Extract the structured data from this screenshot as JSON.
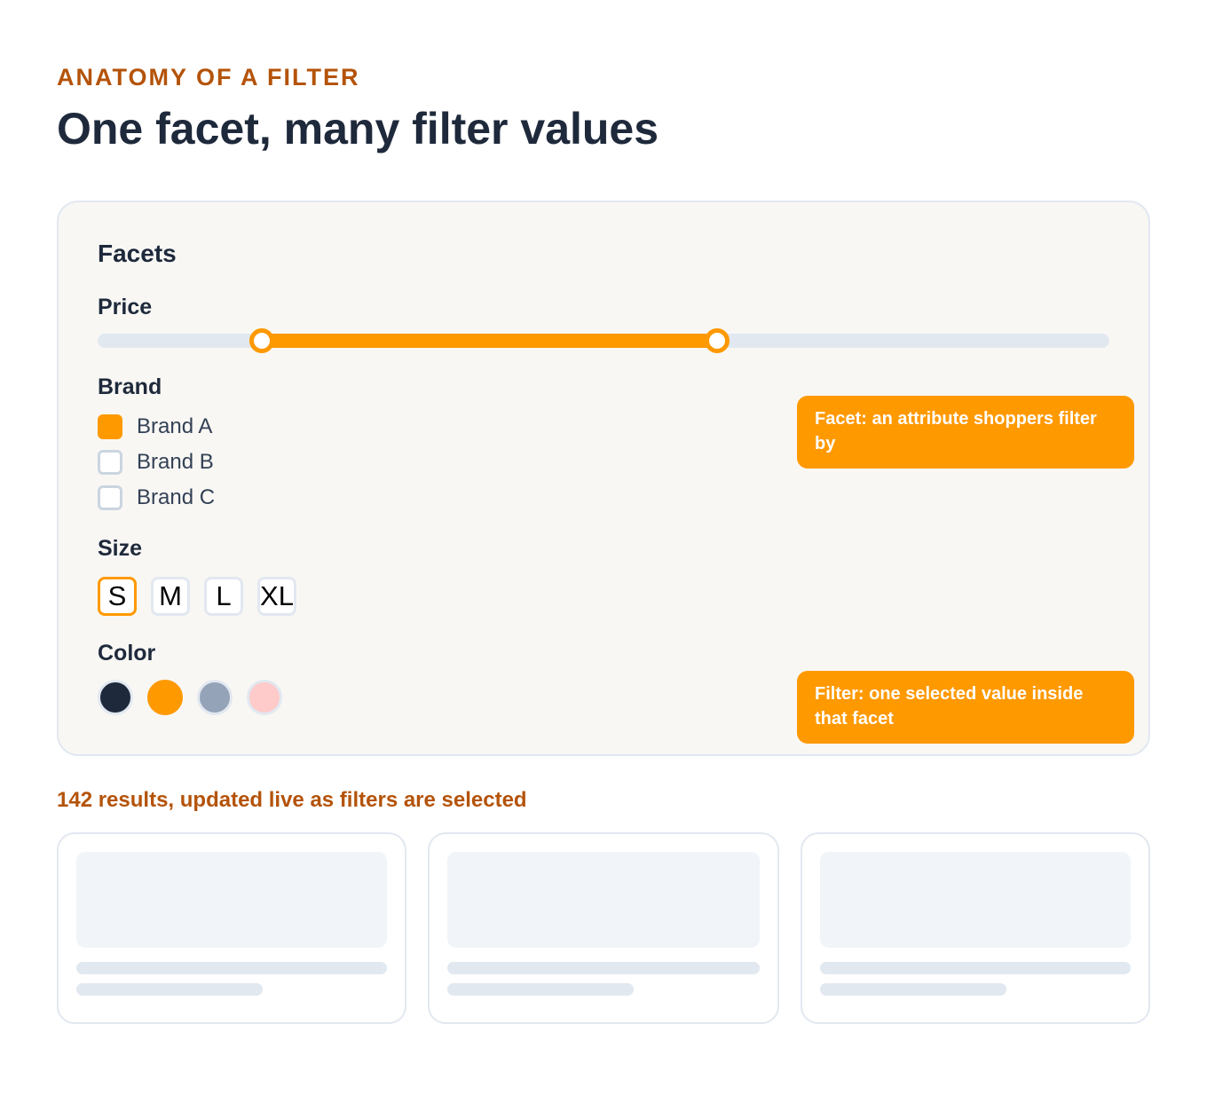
{
  "header": {
    "eyebrow": "ANATOMY OF A FILTER",
    "title": "One facet, many filter values"
  },
  "panel": {
    "title": "Facets",
    "price": {
      "label": "Price",
      "range_start_fraction": 0.162,
      "range_end_fraction": 0.612
    },
    "brand": {
      "label": "Brand",
      "options": [
        {
          "label": "Brand A",
          "checked": true
        },
        {
          "label": "Brand B",
          "checked": false
        },
        {
          "label": "Brand C",
          "checked": false
        }
      ]
    },
    "size": {
      "label": "Size",
      "options": [
        {
          "label": "S",
          "selected": true
        },
        {
          "label": "M",
          "selected": false
        },
        {
          "label": "L",
          "selected": false
        },
        {
          "label": "XL",
          "selected": false
        }
      ]
    },
    "color": {
      "label": "Color",
      "swatches": [
        "#1e293b",
        "#ff9900",
        "#94a3b8",
        "#fecaca"
      ],
      "selected_index": 1
    }
  },
  "callouts": {
    "facet": "Facet: an attribute shoppers filter by",
    "filter": "Filter: one selected value inside that facet"
  },
  "results": {
    "text": "142 results, updated live as filters are selected"
  },
  "colors": {
    "accent": "#ff9900",
    "eyebrow": "#b45309",
    "text": "#1e293b"
  }
}
